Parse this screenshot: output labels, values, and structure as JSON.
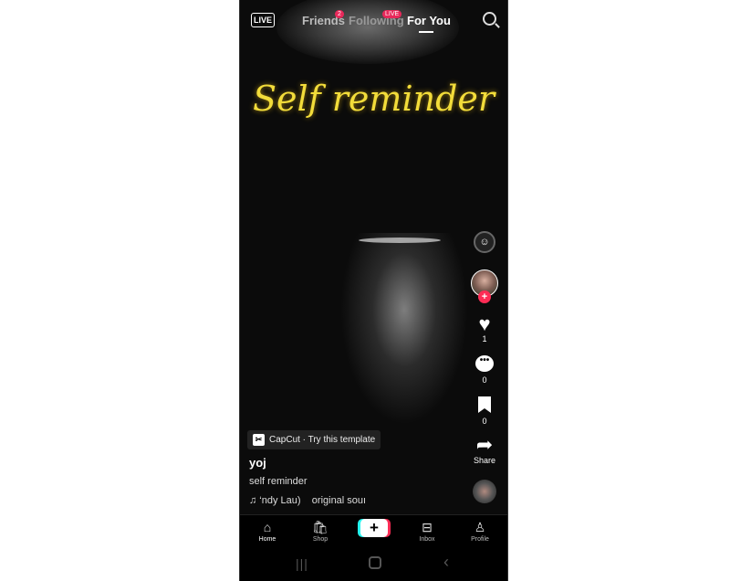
{
  "top_nav": {
    "live_label": "LIVE",
    "tabs": [
      {
        "label": "Friends",
        "badge": "2"
      },
      {
        "label": "Following",
        "badge": "LIVE"
      },
      {
        "label": "For You",
        "active": true
      }
    ],
    "search_icon": "search-icon"
  },
  "video": {
    "overlay_text": "Self reminder"
  },
  "actions": {
    "likes": "1",
    "comments": "0",
    "saves": "0",
    "share_label": "Share"
  },
  "post": {
    "template_label": "CapCut · Try this template",
    "username": "yoj",
    "description": "self reminder",
    "music": "♫ ‘ndy Lau)    original souı"
  },
  "bottom_nav": [
    {
      "label": "Home",
      "icon": "home-icon"
    },
    {
      "label": "Shop",
      "icon": "bag-icon"
    },
    {
      "label": "",
      "icon": "plus-icon"
    },
    {
      "label": "Inbox",
      "icon": "inbox-icon"
    },
    {
      "label": "Profile",
      "icon": "person-icon"
    }
  ],
  "colors": {
    "accent": "#fe2c55",
    "title": "#f2dc3a"
  }
}
